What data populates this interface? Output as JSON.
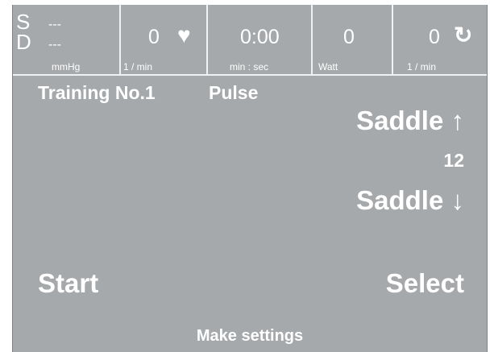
{
  "status_bar": {
    "blood_pressure": {
      "systolic_label": "S",
      "systolic_value": "---",
      "diastolic_label": "D",
      "diastolic_value": "---",
      "unit": "mmHg"
    },
    "pulse": {
      "value": "0",
      "unit": "1 / min",
      "icon": "heart-icon"
    },
    "time": {
      "value": "0:00",
      "unit": "min : sec"
    },
    "power": {
      "value": "0",
      "unit": "Watt"
    },
    "cadence": {
      "value": "0",
      "unit": "1 / min",
      "icon": "rotation-icon"
    }
  },
  "main": {
    "training_label": "Training No.1",
    "mode_label": "Pulse",
    "saddle_up_label": "Saddle ↑",
    "saddle_value": "12",
    "saddle_down_label": "Saddle ↓",
    "start_label": "Start",
    "select_label": "Select",
    "hint": "Make settings"
  },
  "colors": {
    "screen_background": "#a6a9ab",
    "text": "#ffffff",
    "divider": "#f1f1f1"
  }
}
